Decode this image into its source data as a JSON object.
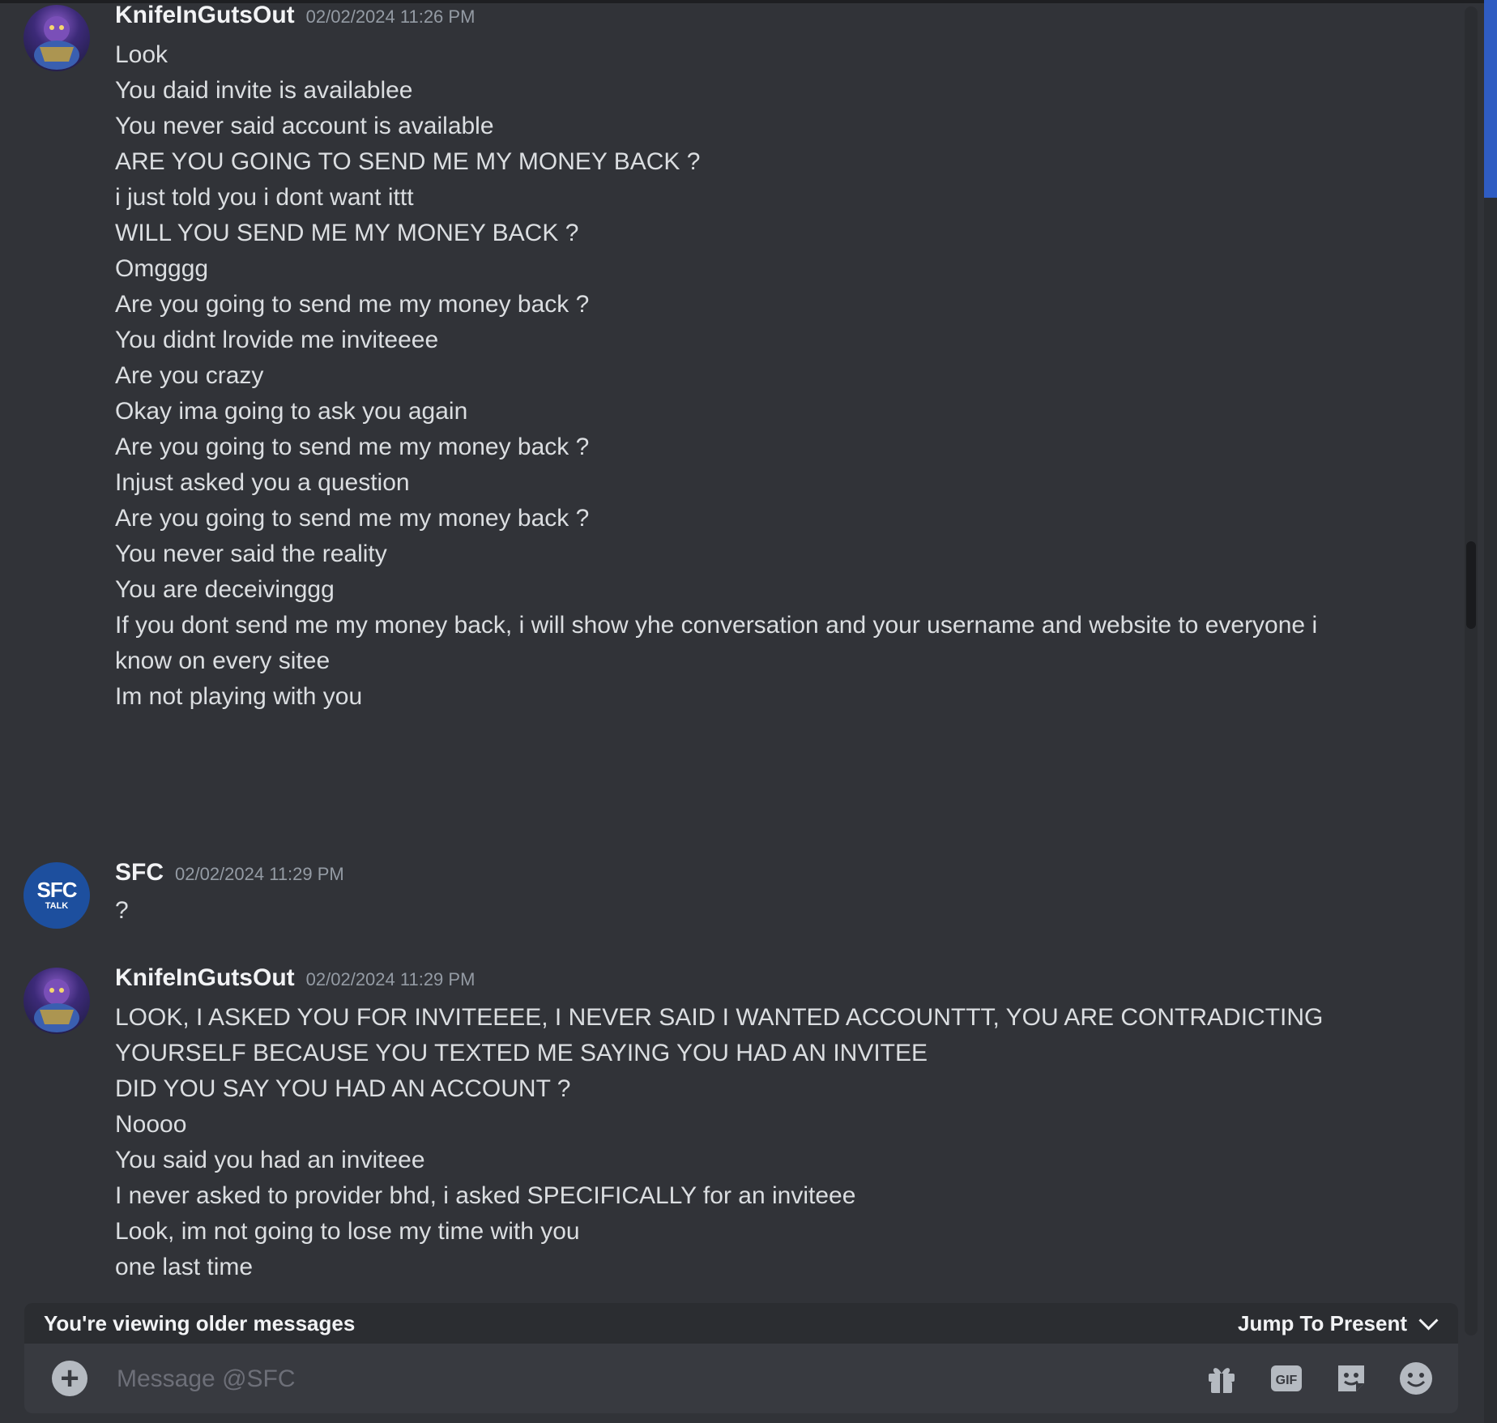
{
  "messages": [
    {
      "author": "KnifeInGutsOut",
      "timestamp": "02/02/2024 11:26 PM",
      "lines": [
        "Look",
        "You daid invite is availablee",
        "You never said account is available",
        "ARE YOU GOING TO SEND ME MY MONEY BACK ?",
        "i just told you i dont want ittt",
        "WILL YOU SEND ME MY MONEY BACK ?",
        "Omgggg",
        "Are you going to send me my money back ?",
        "You didnt lrovide me inviteeee",
        "Are you crazy",
        "Okay ima going to ask you again",
        "Are you going to send me my money back ?",
        "Injust asked you a question",
        "Are you going to send me my money back ?",
        "You never said the reality",
        "You are deceivinggg",
        "If you dont send me my money back, i will show yhe conversation and your username and website to everyone i know on every sitee",
        "Im not playing with you"
      ]
    },
    {
      "author": "SFC",
      "timestamp": "02/02/2024 11:29 PM",
      "avatar_text": {
        "line1": "SFC",
        "line2": "TALK"
      },
      "lines": [
        "?"
      ]
    },
    {
      "author": "KnifeInGutsOut",
      "timestamp": "02/02/2024 11:29 PM",
      "lines": [
        "LOOK, I ASKED YOU FOR INVITEEEE, I NEVER SAID I WANTED ACCOUNTTT, YOU ARE CONTRADICTING YOURSELF BECAUSE YOU TEXTED ME SAYING YOU HAD AN INVITEE",
        "DID YOU SAY YOU HAD AN ACCOUNT ?",
        "Noooo",
        "You said you had an inviteee",
        "I never asked to provider bhd, i asked  SPECIFICALLY for an inviteee",
        "Look, im not going to lose my time with you",
        "one last time"
      ]
    }
  ],
  "banner": {
    "text": "You're viewing older messages",
    "jump_label": "Jump To Present",
    "jump_icon": "chevron-down-icon"
  },
  "composer": {
    "placeholder": "Message @SFC",
    "icons": [
      "plus-circle-icon",
      "gift-icon",
      "gif-icon",
      "sticker-icon",
      "emoji-icon"
    ]
  },
  "colors": {
    "background": "#313338",
    "text": "#dbdee1",
    "username": "#f2f3f5",
    "timestamp": "#949ba4",
    "composer": "#383a40",
    "accent": "#2f5cc2"
  }
}
